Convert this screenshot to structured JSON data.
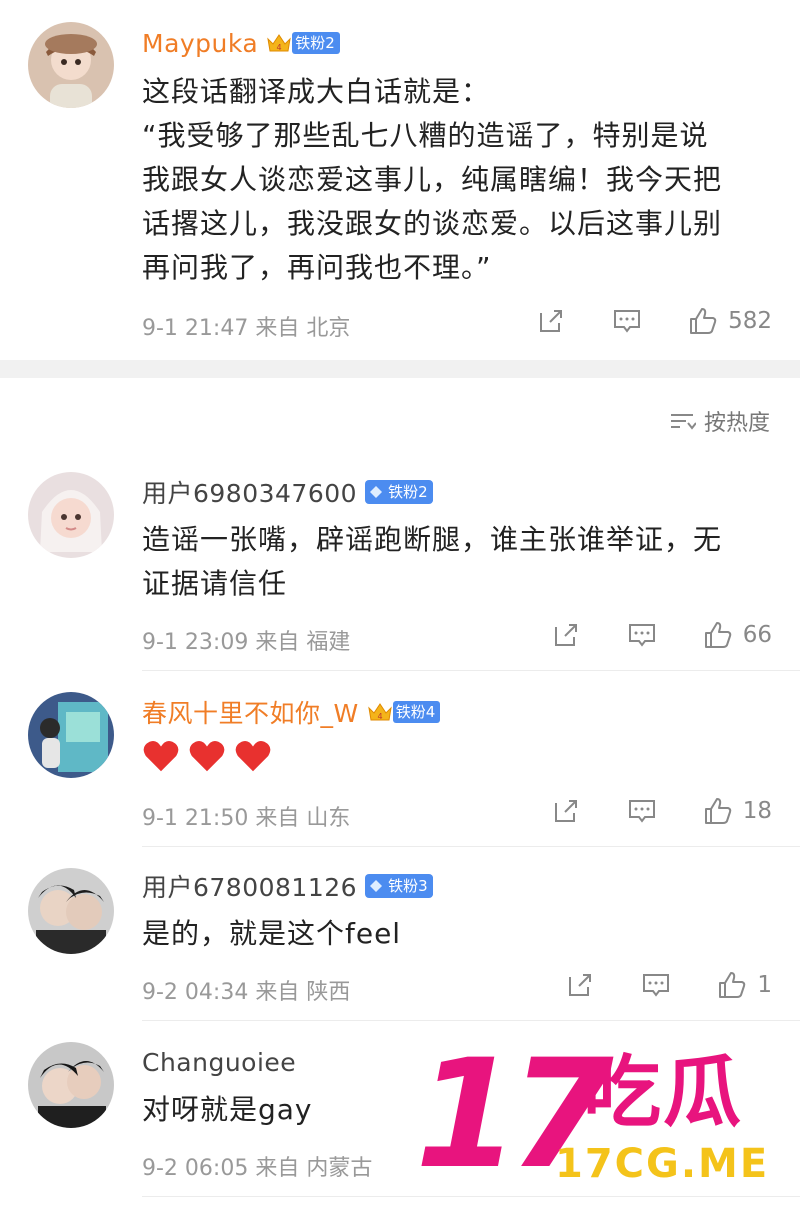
{
  "comments_top": {
    "username": "Maypuka",
    "badge": "铁粉2",
    "text_lines": [
      "这段话翻译成大白话就是：",
      "“我受够了那些乱七八糟的造谣了，特别是说",
      "我跟女人谈恋爱这事儿，纯属瞎编！我今天把",
      "话撂这儿，我没跟女的谈恋爱。以后这事儿别",
      "再问我了，再问我也不理。”"
    ],
    "time": "9-1 21:47 来自 北京",
    "likes": "582"
  },
  "sort_label": "按热度",
  "comments": [
    {
      "username": "用户6980347600",
      "badge": "铁粉2",
      "text_lines": [
        "造谣一张嘴，辟谣跑断腿，谁主张谁举证，无",
        "证据请信任"
      ],
      "time": "9-1 23:09 来自 福建",
      "likes": "66"
    },
    {
      "username": "春风十里不如你_W",
      "badge": "铁粉4",
      "text_lines": [
        "❤️❤️❤️"
      ],
      "time": "9-1 21:50 来自 山东",
      "likes": "18"
    },
    {
      "username": "用户6780081126",
      "badge": "铁粉3",
      "text_lines": [
        "是的，就是这个feel"
      ],
      "time": "9-2 04:34 来自 陕西",
      "likes": "1"
    },
    {
      "username": "Changuoiee",
      "badge": "",
      "text_lines": [
        "对呀就是gay"
      ],
      "time": "9-2 06:05 来自 内蒙古",
      "likes": ""
    }
  ],
  "watermark": {
    "number": "17",
    "chinese": "吃瓜",
    "url": "17CG.ME"
  },
  "colors": {
    "vip_name": "#f07d26",
    "badge_blue": "#4c8cf0",
    "meta_gray": "#999999",
    "watermark_pink": "#e8147e",
    "watermark_yellow": "#f4c31a",
    "heart_red": "#e8312f"
  }
}
